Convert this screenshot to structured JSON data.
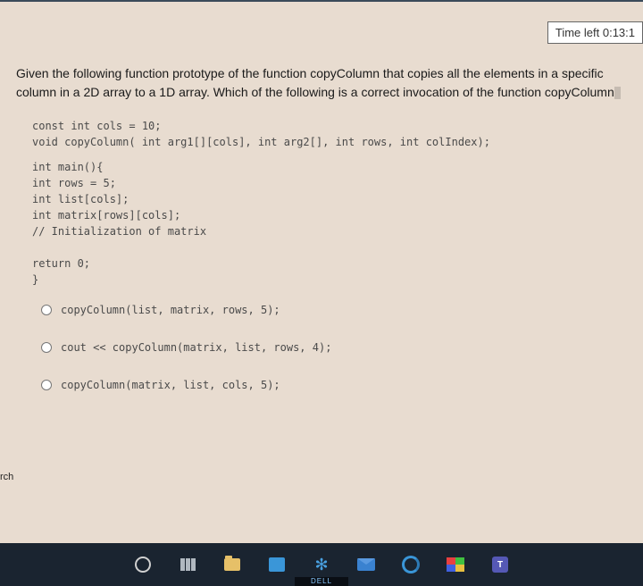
{
  "timer": {
    "label": "Time left 0:13:1"
  },
  "question": {
    "intro1": "Given the following function prototype of the function ",
    "fn1": "copyColumn",
    "intro2": " that copies all the elements in a specific column in a 2D array to a 1D array. Which of the following is a correct invocation of the function ",
    "fn2": "copyColumn"
  },
  "code": {
    "decl": "const int cols = 10;\nvoid copyColumn( int arg1[][cols], int arg2[], int rows, int colIndex);",
    "main": "int main(){\nint rows = 5;\nint list[cols];\nint matrix[rows][cols];\n// Initialization of matrix\n\nreturn 0;\n}"
  },
  "options": [
    {
      "text": "copyColumn(list, matrix, rows, 5);"
    },
    {
      "text": "cout << copyColumn(matrix, list, rows, 4);"
    },
    {
      "text": "copyColumn(matrix, list, cols, 5);"
    }
  ],
  "left_tab": "rch",
  "brand": "DELL"
}
